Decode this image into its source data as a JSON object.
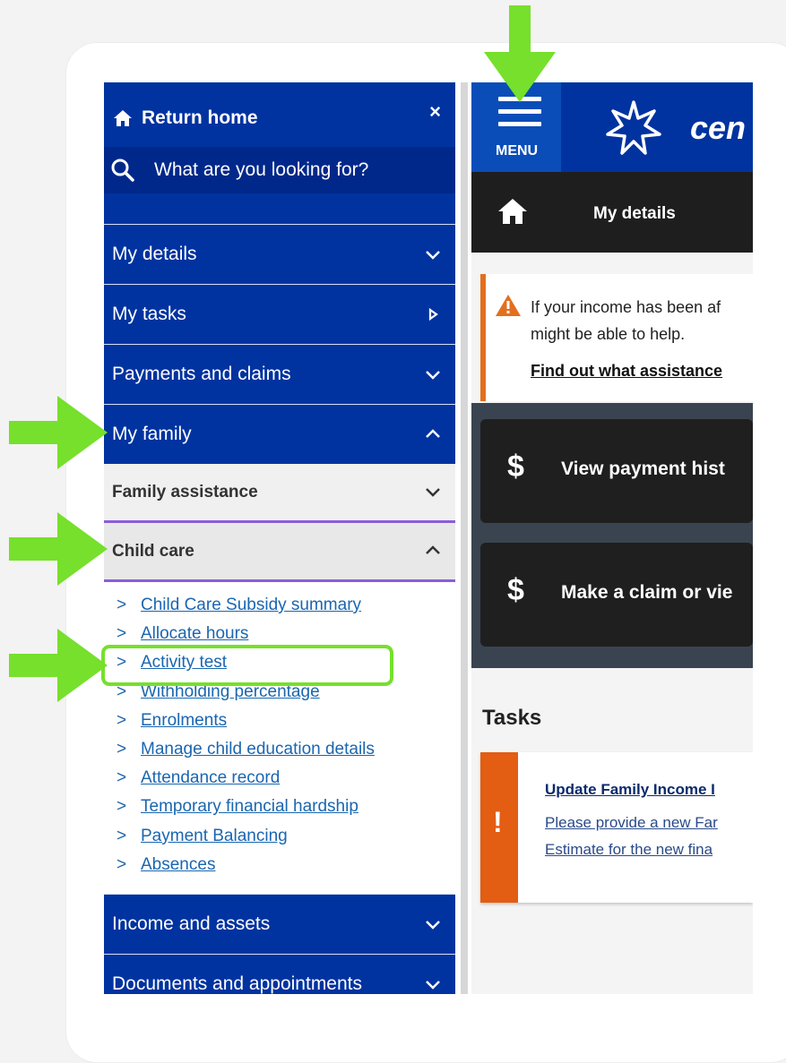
{
  "sidebar": {
    "return_home": "Return home",
    "close": "×",
    "search_placeholder": "What are you looking for?",
    "nav": {
      "my_details": "My details",
      "my_tasks": "My tasks",
      "payments_claims": "Payments and claims",
      "my_family": "My family",
      "income_assets": "Income and assets",
      "documents_appointments": "Documents and appointments"
    },
    "family_assistance": "Family assistance",
    "child_care": "Child care",
    "links": [
      "Child Care Subsidy summary",
      "Allocate hours",
      "Activity test",
      "Withholding percentage",
      "Enrolments",
      "Manage child education details",
      "Attendance record",
      "Temporary financial hardship",
      "Payment Balancing",
      "Absences"
    ],
    "link_marker": ">"
  },
  "header": {
    "menu_label": "MENU",
    "logo_text": "cen"
  },
  "dark_bar": {
    "label": "My details"
  },
  "alert": {
    "line1": "If your income has been af",
    "line2": "might be able to help.",
    "link": "Find out what assistance"
  },
  "tiles": {
    "symbol": "$",
    "view_payment": "View payment hist",
    "make_claim": "Make a claim or vie"
  },
  "tasks": {
    "title": "Tasks",
    "card_title": "Update Family Income I",
    "card_line1": "Please provide a new Far",
    "card_line2": "Estimate for the new fina",
    "card_symbol": "!"
  },
  "colors": {
    "brand_blue": "#0033a0",
    "annotation_green": "#76e02c",
    "alert_orange": "#e36f1e",
    "link_blue": "#1a66b0",
    "child_care_underline": "#8a5ed8"
  }
}
